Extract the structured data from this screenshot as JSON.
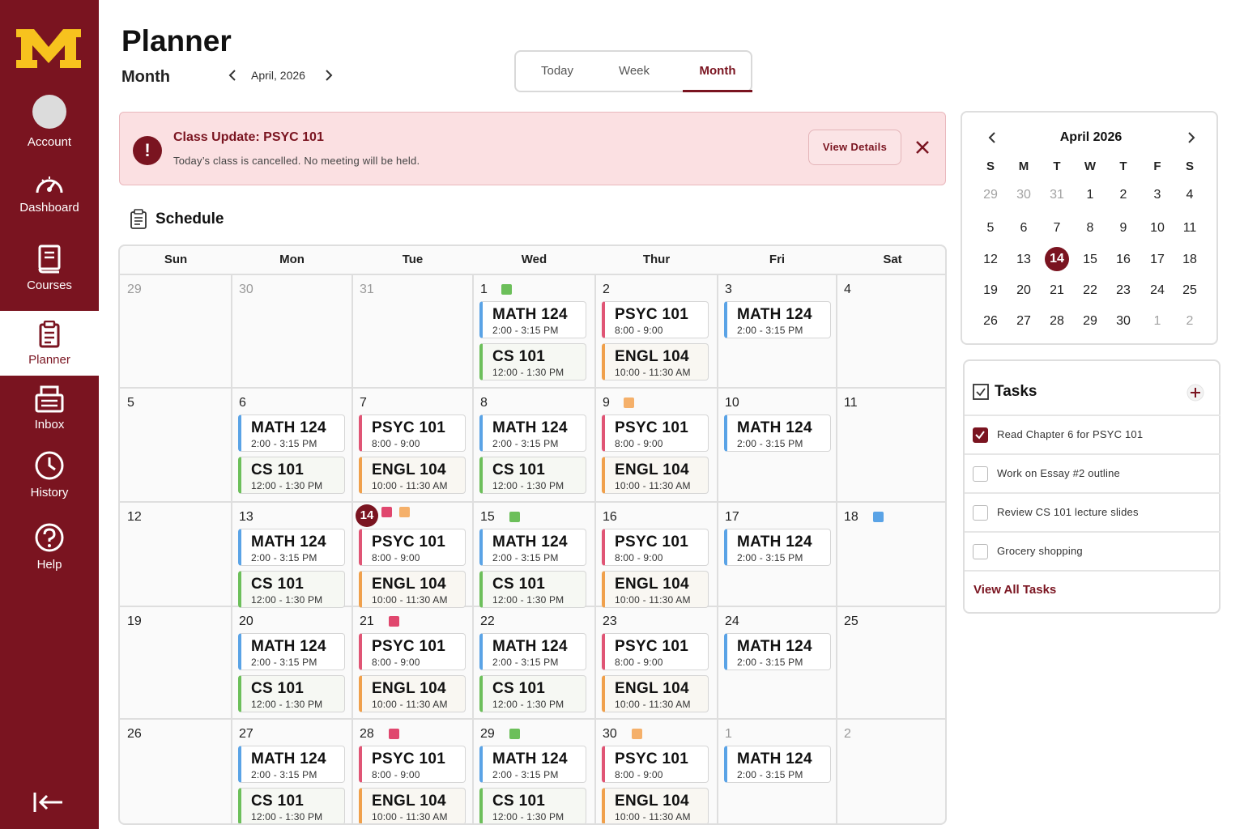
{
  "sidebar": {
    "items": [
      {
        "label": "Account",
        "icon": "avatar"
      },
      {
        "label": "Dashboard",
        "icon": "gauge-icon"
      },
      {
        "label": "Courses",
        "icon": "book-icon"
      },
      {
        "label": "Planner",
        "icon": "clipboard-icon",
        "active": true
      },
      {
        "label": "Inbox",
        "icon": "inbox-icon"
      },
      {
        "label": "History",
        "icon": "clock-icon"
      },
      {
        "label": "Help",
        "icon": "help-icon"
      }
    ],
    "collapse_icon": "collapse-left-icon"
  },
  "header": {
    "title": "Planner",
    "subtitle": "Month",
    "current_month": "April, 2026"
  },
  "view_toggle": {
    "options": [
      "Today",
      "Week",
      "Month"
    ],
    "selected": "Month"
  },
  "alert": {
    "title": "Class Update: PSYC 101",
    "message": "Today’s class is cancelled. No meeting will be held.",
    "button": "View Details"
  },
  "schedule": {
    "title": "Schedule",
    "days_of_week": [
      "Sun",
      "Mon",
      "Tue",
      "Wed",
      "Thur",
      "Fri",
      "Sat"
    ],
    "weeks": [
      [
        {
          "day": "29",
          "muted": true,
          "events": []
        },
        {
          "day": "30",
          "muted": true,
          "events": []
        },
        {
          "day": "31",
          "muted": true,
          "events": []
        },
        {
          "day": "1",
          "dots": [
            "green"
          ],
          "events": [
            {
              "name": "MATH 124",
              "time": "2:00 - 3:15 PM"
            },
            {
              "name": "CS 101",
              "time": "12:00 - 1:30 PM"
            }
          ]
        },
        {
          "day": "2",
          "events": [
            {
              "name": "PSYC 101",
              "time": "8:00 - 9:00"
            },
            {
              "name": "ENGL 104",
              "time": "10:00 - 11:30 AM"
            }
          ]
        },
        {
          "day": "3",
          "events": [
            {
              "name": "MATH 124",
              "time": "2:00 - 3:15 PM"
            }
          ]
        },
        {
          "day": "4",
          "events": []
        }
      ],
      [
        {
          "day": "5",
          "events": []
        },
        {
          "day": "6",
          "events": [
            {
              "name": "MATH 124",
              "time": "2:00 - 3:15 PM"
            },
            {
              "name": "CS 101",
              "time": "12:00 - 1:30 PM"
            }
          ]
        },
        {
          "day": "7",
          "events": [
            {
              "name": "PSYC 101",
              "time": "8:00 - 9:00"
            },
            {
              "name": "ENGL 104",
              "time": "10:00 - 11:30 AM"
            }
          ]
        },
        {
          "day": "8",
          "events": [
            {
              "name": "MATH 124",
              "time": "2:00 - 3:15 PM"
            },
            {
              "name": "CS 101",
              "time": "12:00 - 1:30 PM"
            }
          ]
        },
        {
          "day": "9",
          "dots": [
            "orange"
          ],
          "events": [
            {
              "name": "PSYC 101",
              "time": "8:00 - 9:00"
            },
            {
              "name": "ENGL 104",
              "time": "10:00 - 11:30 AM"
            }
          ]
        },
        {
          "day": "10",
          "events": [
            {
              "name": "MATH 124",
              "time": "2:00 - 3:15 PM"
            }
          ]
        },
        {
          "day": "11",
          "events": []
        }
      ],
      [
        {
          "day": "12",
          "events": []
        },
        {
          "day": "13",
          "events": [
            {
              "name": "MATH 124",
              "time": "2:00 - 3:15 PM"
            },
            {
              "name": "CS 101",
              "time": "12:00 - 1:30 PM"
            }
          ]
        },
        {
          "day": "14",
          "today": true,
          "dots": [
            "pink",
            "orange"
          ],
          "events": [
            {
              "name": "PSYC 101",
              "time": "8:00 - 9:00"
            },
            {
              "name": "ENGL 104",
              "time": "10:00 - 11:30 AM"
            }
          ]
        },
        {
          "day": "15",
          "dots": [
            "green"
          ],
          "events": [
            {
              "name": "MATH 124",
              "time": "2:00 - 3:15 PM"
            },
            {
              "name": "CS 101",
              "time": "12:00 - 1:30 PM"
            }
          ]
        },
        {
          "day": "16",
          "events": [
            {
              "name": "PSYC 101",
              "time": "8:00 - 9:00"
            },
            {
              "name": "ENGL 104",
              "time": "10:00 - 11:30 AM"
            }
          ]
        },
        {
          "day": "17",
          "events": [
            {
              "name": "MATH 124",
              "time": "2:00 - 3:15 PM"
            }
          ]
        },
        {
          "day": "18",
          "dots": [
            "blue"
          ],
          "events": []
        }
      ],
      [
        {
          "day": "19",
          "events": []
        },
        {
          "day": "20",
          "events": [
            {
              "name": "MATH 124",
              "time": "2:00 - 3:15 PM"
            },
            {
              "name": "CS 101",
              "time": "12:00 - 1:30 PM"
            }
          ]
        },
        {
          "day": "21",
          "dots": [
            "pink"
          ],
          "events": [
            {
              "name": "PSYC 101",
              "time": "8:00 - 9:00"
            },
            {
              "name": "ENGL 104",
              "time": "10:00 - 11:30 AM"
            }
          ]
        },
        {
          "day": "22",
          "events": [
            {
              "name": "MATH 124",
              "time": "2:00 - 3:15 PM"
            },
            {
              "name": "CS 101",
              "time": "12:00 - 1:30 PM"
            }
          ]
        },
        {
          "day": "23",
          "events": [
            {
              "name": "PSYC 101",
              "time": "8:00 - 9:00"
            },
            {
              "name": "ENGL 104",
              "time": "10:00 - 11:30 AM"
            }
          ]
        },
        {
          "day": "24",
          "events": [
            {
              "name": "MATH 124",
              "time": "2:00 - 3:15 PM"
            }
          ]
        },
        {
          "day": "25",
          "events": []
        }
      ],
      [
        {
          "day": "26",
          "events": []
        },
        {
          "day": "27",
          "events": [
            {
              "name": "MATH 124",
              "time": "2:00 - 3:15 PM"
            },
            {
              "name": "CS 101",
              "time": "12:00 - 1:30 PM"
            }
          ]
        },
        {
          "day": "28",
          "dots": [
            "pink"
          ],
          "events": [
            {
              "name": "PSYC 101",
              "time": "8:00 - 9:00"
            },
            {
              "name": "ENGL 104",
              "time": "10:00 - 11:30 AM"
            }
          ]
        },
        {
          "day": "29",
          "dots": [
            "green"
          ],
          "events": [
            {
              "name": "MATH 124",
              "time": "2:00 - 3:15 PM"
            },
            {
              "name": "CS 101",
              "time": "12:00 - 1:30 PM"
            }
          ]
        },
        {
          "day": "30",
          "dots": [
            "orange"
          ],
          "events": [
            {
              "name": "PSYC 101",
              "time": "8:00 - 9:00"
            },
            {
              "name": "ENGL 104",
              "time": "10:00 - 11:30 AM"
            }
          ]
        },
        {
          "day": "1",
          "muted": true,
          "events": [
            {
              "name": "MATH 124",
              "time": "2:00 - 3:15 PM"
            }
          ]
        },
        {
          "day": "2",
          "muted": true,
          "events": []
        }
      ]
    ]
  },
  "mini_calendar": {
    "title": "April 2026",
    "days_of_week": [
      "S",
      "M",
      "T",
      "W",
      "T",
      "F",
      "S"
    ],
    "weeks": [
      [
        "29",
        "30",
        "31",
        "1",
        "2",
        "3",
        "4"
      ],
      [
        "5",
        "6",
        "7",
        "8",
        "9",
        "10",
        "11"
      ],
      [
        "12",
        "13",
        "14",
        "15",
        "16",
        "17",
        "18"
      ],
      [
        "19",
        "20",
        "21",
        "22",
        "23",
        "24",
        "25"
      ],
      [
        "26",
        "27",
        "28",
        "29",
        "30",
        "1",
        "2"
      ]
    ],
    "today": "14"
  },
  "tasks": {
    "title": "Tasks",
    "items": [
      {
        "label": "Read Chapter 6 for PSYC 101",
        "checked": true
      },
      {
        "label": "Work on Essay #2 outline",
        "checked": false
      },
      {
        "label": "Review CS 101 lecture slides",
        "checked": false
      },
      {
        "label": "Grocery shopping",
        "checked": false
      }
    ],
    "view_all": "View All Tasks"
  },
  "colors": {
    "brand": "#7a1420",
    "accent_gold": "#f7c21e",
    "math": "#5aa3e6",
    "cs": "#6cbf5a",
    "psyc": "#e05575",
    "engl": "#f0a04b",
    "dot_green": "#6cbf5a",
    "dot_orange": "#f5b06a",
    "dot_pink": "#e0476e",
    "dot_blue": "#5aa3e6"
  }
}
